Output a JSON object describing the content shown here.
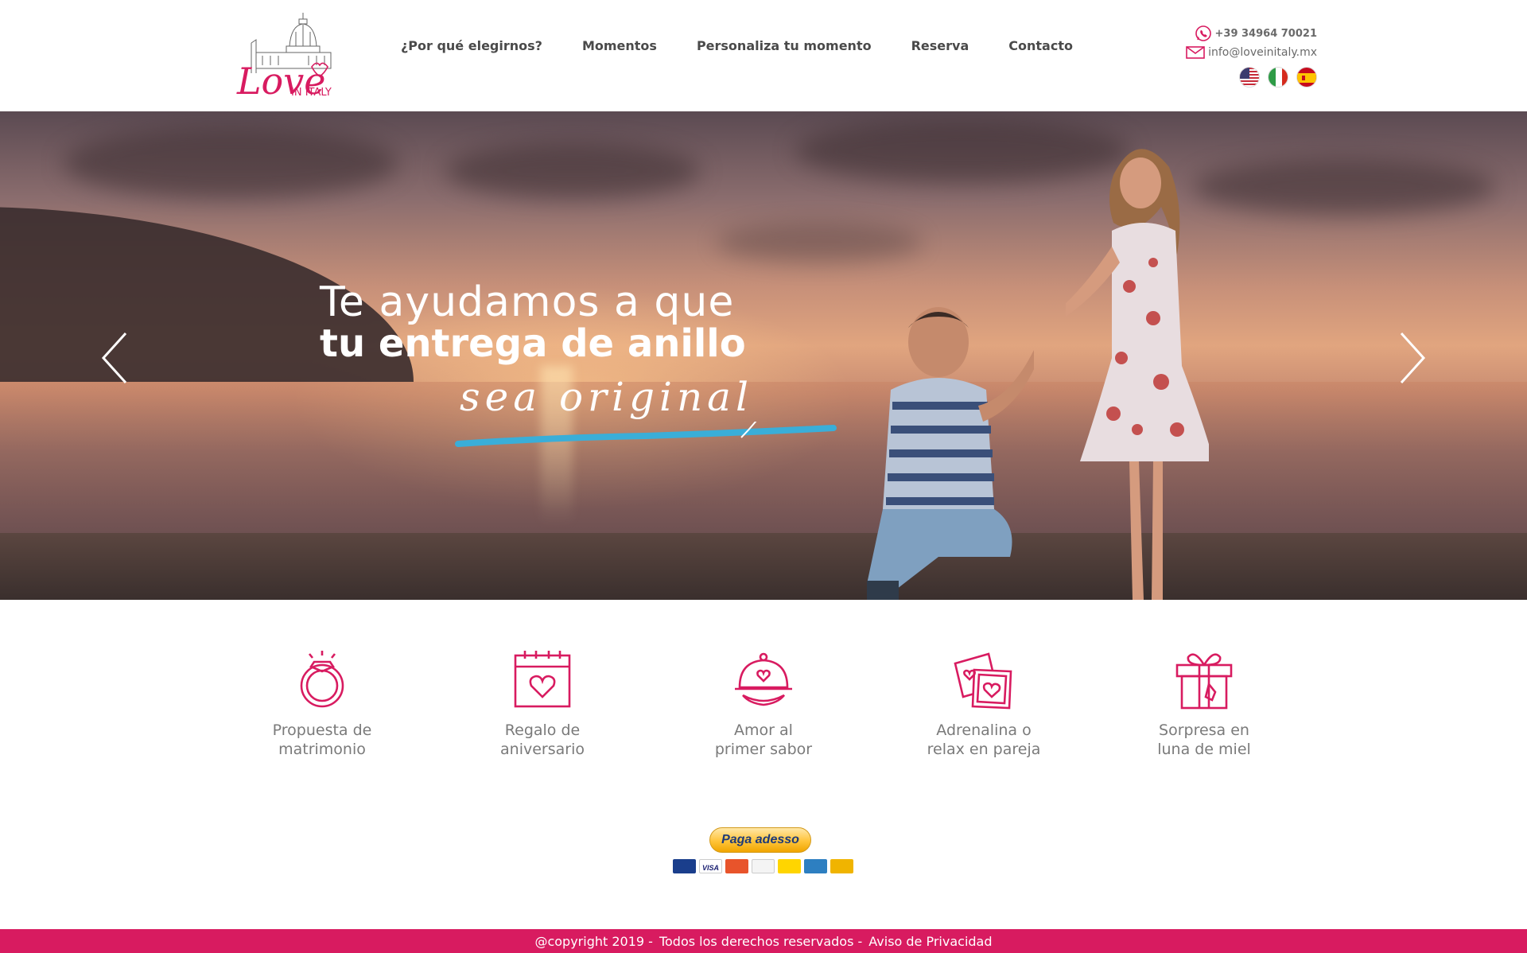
{
  "brand": {
    "logo_text": "Love",
    "logo_subtext": "IN ITALY",
    "accent_color": "#d81b60"
  },
  "nav": {
    "items": [
      {
        "label": "¿Por qué elegirnos?"
      },
      {
        "label": "Momentos"
      },
      {
        "label": "Personaliza tu momento"
      },
      {
        "label": "Reserva"
      },
      {
        "label": "Contacto"
      }
    ]
  },
  "contact": {
    "phone": "+39 34964 70021",
    "email": "info@loveinitaly.mx",
    "phone_icon": "whatsapp-icon",
    "email_icon": "envelope-icon"
  },
  "languages": [
    {
      "code": "en",
      "icon": "us-flag-icon"
    },
    {
      "code": "it",
      "icon": "italy-flag-icon"
    },
    {
      "code": "es",
      "icon": "spain-flag-icon"
    }
  ],
  "hero": {
    "line1": "Te ayudamos a que",
    "line2": "tu entrega de anillo",
    "line3": "sea original",
    "prev_icon": "chevron-left-icon",
    "next_icon": "chevron-right-icon",
    "underline_color": "#3aaed8"
  },
  "services": [
    {
      "line1": "Propuesta de",
      "line2": "matrimonio",
      "icon": "ring-icon"
    },
    {
      "line1": "Regalo de",
      "line2": "aniversario",
      "icon": "calendar-heart-icon"
    },
    {
      "line1": "Amor al",
      "line2": "primer sabor",
      "icon": "cloche-heart-icon"
    },
    {
      "line1": "Adrenalina o",
      "line2": "relax en pareja",
      "icon": "photos-heart-icon"
    },
    {
      "line1": "Sorpresa en",
      "line2": "luna de miel",
      "icon": "gift-icon"
    }
  ],
  "payment": {
    "button_label": "Paga adesso",
    "cards": [
      "Maestro",
      "VISA",
      "MasterCard",
      "PayPal",
      "PostePay",
      "American Express",
      "Aura"
    ]
  },
  "footer": {
    "copyright": "@copyright 2019 -",
    "rights": "Todos los derechos reservados -",
    "privacy": "Aviso de Privacidad"
  }
}
